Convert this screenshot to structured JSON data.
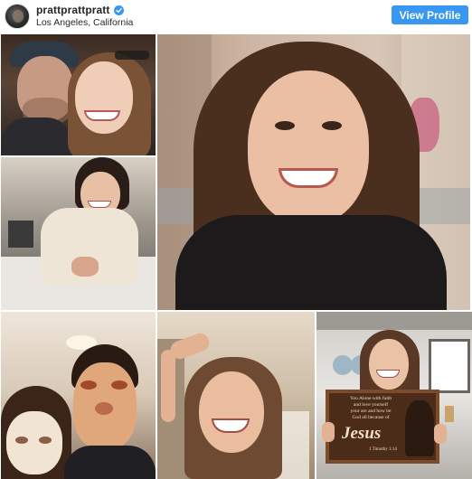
{
  "header": {
    "username": "prattprattpratt",
    "location": "Los Angeles, California",
    "view_profile_label": "View Profile",
    "verified": true,
    "accent_color": "#3897f0"
  },
  "collage": {
    "tiles": [
      {
        "subject": "couple-kissing-photo"
      },
      {
        "subject": "smiling-woman-portrait-photo"
      },
      {
        "subject": "woman-in-robe-photo"
      },
      {
        "subject": "face-mask-selfie-photo"
      },
      {
        "subject": "laughing-woman-photo"
      },
      {
        "subject": "woman-holding-sign-photo"
      }
    ],
    "sign_text": {
      "line1": "You Alone with faith",
      "line2": "and love yourself",
      "line3": "your are and how be",
      "line4": "God all because of",
      "title": "Jesus",
      "reference": "1 Timothy 1:14"
    }
  }
}
